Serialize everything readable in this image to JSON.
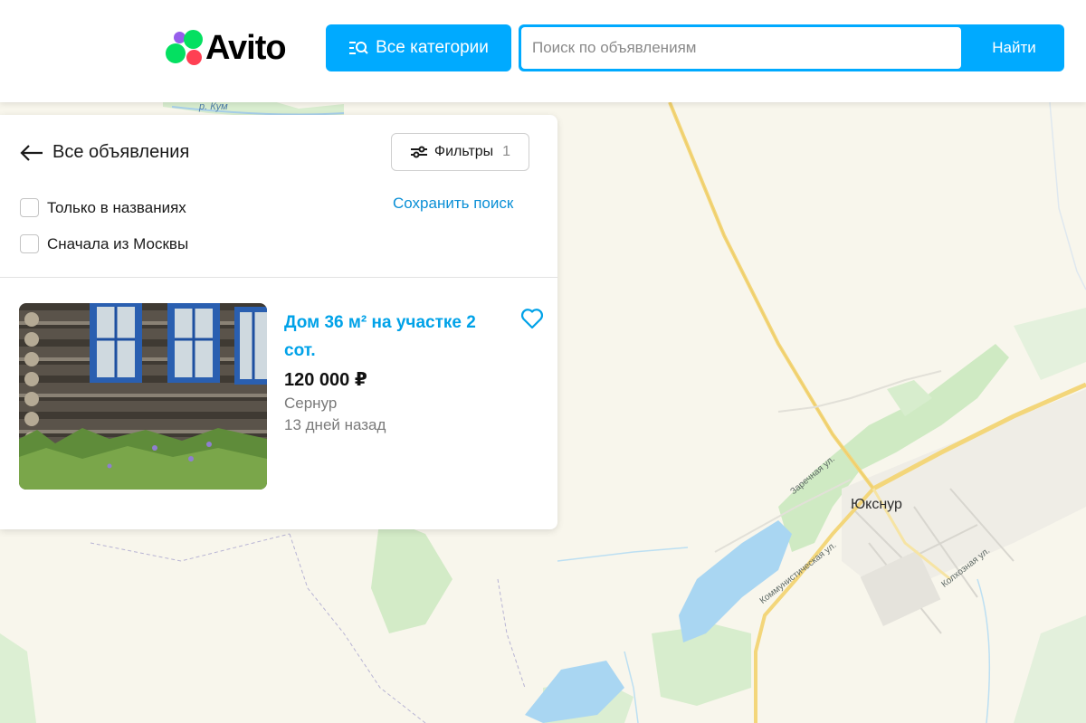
{
  "header": {
    "logo_text": "Avito",
    "categories_label": "Все категории",
    "search_placeholder": "Поиск по объявлениям",
    "search_button": "Найти"
  },
  "panel": {
    "back_label": "Все объявления",
    "filters_label": "Фильтры",
    "filters_count": "1",
    "checkbox_titles_only": "Только в названиях",
    "checkbox_moscow_first": "Сначала из Москвы",
    "save_search": "Сохранить поиск"
  },
  "listing": {
    "title": "Дом 36 м² на участке 2 сот.",
    "price": "120 000 ₽",
    "city": "Сернур",
    "date": "13 дней назад"
  },
  "map": {
    "river_label": "р. Кум",
    "town_label": "Юкснур",
    "street_zarechnaya": "Заречная ул.",
    "street_kommunisticheskaya": "Коммунистическая ул.",
    "street_kolkhoznaya": "Колхозная ул."
  },
  "colors": {
    "brand_blue": "#00aaff",
    "link_blue": "#0a8fd6",
    "title_blue": "#00a2e8",
    "pin_red": "#f24e5b"
  }
}
